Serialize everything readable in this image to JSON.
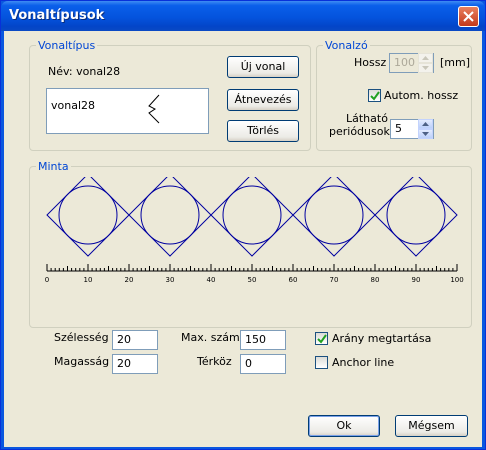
{
  "window": {
    "title": "Vonaltípusok"
  },
  "vonaltipus": {
    "legend": "Vonaltípus",
    "name_label": "Név: vonal28",
    "list_item": "vonal28",
    "new_button": "Új vonal",
    "rename_button": "Átnevezés",
    "delete_button": "Törlés"
  },
  "vonalzo": {
    "legend": "Vonalzó",
    "length_label": "Hossz",
    "length_value": "100",
    "length_unit": "[mm]",
    "auto_length_label": "Autom. hossz",
    "auto_length_checked": true,
    "visible_periods_label_1": "Látható",
    "visible_periods_label_2": "periódusok",
    "visible_periods_value": "5"
  },
  "minta": {
    "legend": "Minta"
  },
  "ruler": {
    "min": 0,
    "max": 100,
    "major_step": 10,
    "minor_step": 1,
    "labels": [
      "0",
      "10",
      "20",
      "30",
      "40",
      "50",
      "60",
      "70",
      "80",
      "90",
      "100"
    ]
  },
  "pattern": {
    "count": 5,
    "shape": "circle inscribed in diamond",
    "color": "#0000a0"
  },
  "params": {
    "width_label": "Szélesség",
    "width_value": "20",
    "height_label": "Magasság",
    "height_value": "20",
    "max_count_label": "Max. szám",
    "max_count_value": "150",
    "spacing_label": "Térköz",
    "spacing_value": "0",
    "keep_ratio_label": "Arány megtartása",
    "keep_ratio_checked": true,
    "anchor_line_label": "Anchor line",
    "anchor_line_checked": false
  },
  "footer": {
    "ok_button": "Ok",
    "cancel_button": "Mégsem"
  }
}
